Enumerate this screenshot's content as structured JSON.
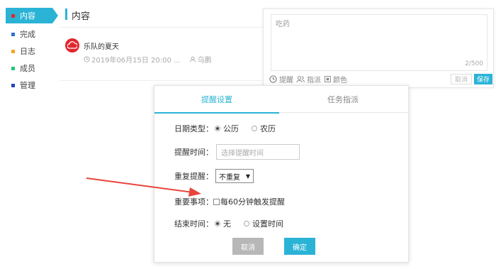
{
  "sidebar": {
    "items": [
      {
        "label": "内容",
        "color": "#e2262e",
        "active": true
      },
      {
        "label": "完成",
        "color": "#2f6fd6"
      },
      {
        "label": "日志",
        "color": "#f5a623"
      },
      {
        "label": "成员",
        "color": "#27c47a"
      },
      {
        "label": "管理",
        "color": "#2346c4"
      }
    ]
  },
  "main": {
    "title": "内容",
    "post": {
      "title": "乐队的夏天",
      "date": "2019年06月15日 20:00 ...",
      "assignee": "乌鹏"
    }
  },
  "editor": {
    "text": "吃药",
    "counter": "2/500",
    "tools": {
      "remind": "提醒",
      "assign": "指派",
      "color": "颜色"
    },
    "cancel": "取消",
    "save": "保存"
  },
  "popup": {
    "tabs": [
      "提醒设置",
      "任务指派"
    ],
    "date_type_label": "日期类型：",
    "date_type_options": [
      "公历",
      "农历"
    ],
    "remind_time_label": "提醒时间：",
    "remind_time_placeholder": "选择提醒时间",
    "repeat_label": "重复提醒：",
    "repeat_value": "不重复",
    "important_label": "重要事项：",
    "important_option": "每60分钟触发提醒",
    "end_time_label": "结束时间：",
    "end_time_options": [
      "无",
      "设置时间"
    ],
    "cancel": "取消",
    "confirm": "确定"
  },
  "colors": {
    "accent": "#2bb3d6",
    "arrow": "#e8453c"
  }
}
